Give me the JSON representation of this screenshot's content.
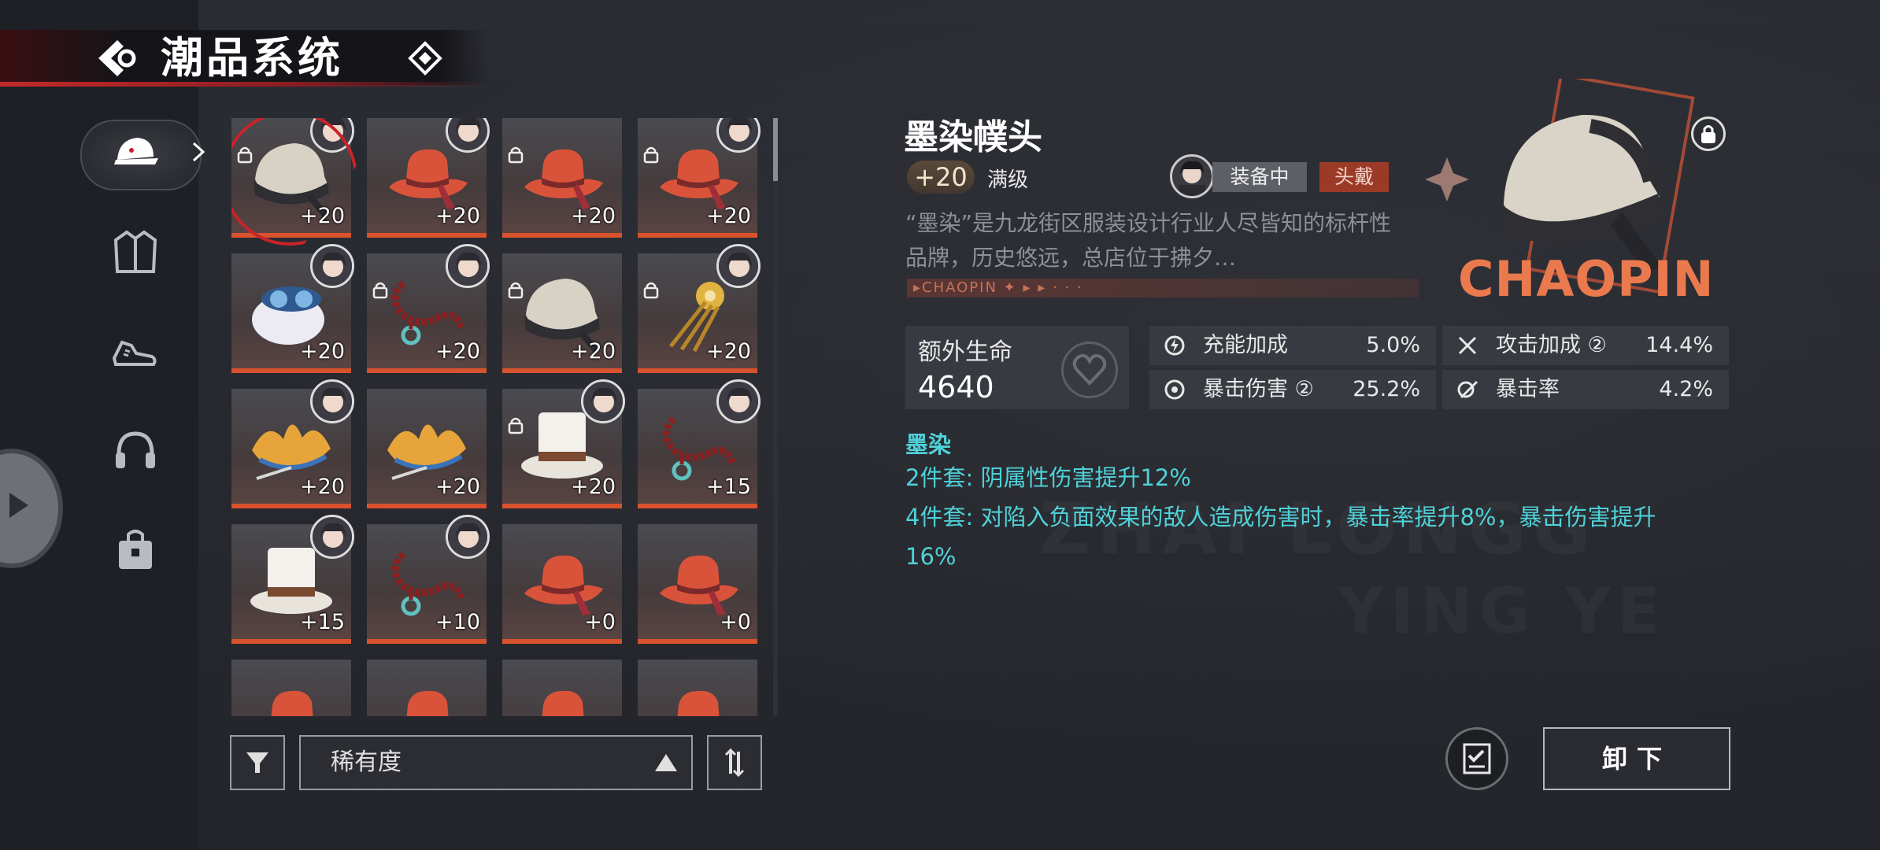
{
  "header": {
    "title": "潮品系统"
  },
  "categories": [
    {
      "icon": "cap-icon",
      "active": true
    },
    {
      "icon": "jacket-icon",
      "active": false
    },
    {
      "icon": "sneakers-icon",
      "active": false
    },
    {
      "icon": "headphones-icon",
      "active": false
    },
    {
      "icon": "bag-icon",
      "active": false
    }
  ],
  "items": [
    {
      "kind": "black-hood",
      "level": "+20",
      "avatar": true,
      "locked": true,
      "selected": true
    },
    {
      "kind": "red-hat",
      "level": "+20",
      "avatar": true,
      "locked": false
    },
    {
      "kind": "red-hat",
      "level": "+20",
      "avatar": false,
      "locked": true
    },
    {
      "kind": "red-hat",
      "level": "+20",
      "avatar": true,
      "locked": true
    },
    {
      "kind": "white-cap",
      "level": "+20",
      "avatar": true,
      "locked": false
    },
    {
      "kind": "red-necklace",
      "level": "+20",
      "avatar": true,
      "locked": true
    },
    {
      "kind": "black-hood",
      "level": "+20",
      "avatar": false,
      "locked": true
    },
    {
      "kind": "gold-hairpin",
      "level": "+20",
      "avatar": true,
      "locked": true
    },
    {
      "kind": "gold-crown",
      "level": "+20",
      "avatar": true,
      "locked": false
    },
    {
      "kind": "gold-crown",
      "level": "+20",
      "avatar": false,
      "locked": false
    },
    {
      "kind": "top-hat",
      "level": "+20",
      "avatar": true,
      "locked": true
    },
    {
      "kind": "red-necklace",
      "level": "+15",
      "avatar": true,
      "locked": false
    },
    {
      "kind": "top-hat",
      "level": "+15",
      "avatar": true,
      "locked": false
    },
    {
      "kind": "red-necklace",
      "level": "+10",
      "avatar": true,
      "locked": false
    },
    {
      "kind": "red-hat",
      "level": "+0",
      "avatar": false,
      "locked": false
    },
    {
      "kind": "red-hat",
      "level": "+0",
      "avatar": false,
      "locked": false
    },
    {
      "kind": "red-hat",
      "level": "",
      "avatar": false,
      "locked": false
    },
    {
      "kind": "red-hat",
      "level": "",
      "avatar": false,
      "locked": false
    },
    {
      "kind": "red-hat",
      "level": "",
      "avatar": false,
      "locked": false
    },
    {
      "kind": "red-hat",
      "level": "",
      "avatar": false,
      "locked": false
    }
  ],
  "sort": {
    "label": "稀有度"
  },
  "detail": {
    "name": "墨染幞头",
    "level_badge": "+20",
    "max_level": "满级",
    "status": "装备中",
    "slot": "头戴",
    "description": "“墨染”是九龙街区服装设计行业人尽皆知的标杆性品牌，历史悠远，总店位于拂夕…",
    "brand_strip": "▸CHAOPIN ✦ ▸ ▸ · · ·",
    "art_text": "CHAOPIN",
    "main_stat": {
      "label": "额外生命",
      "value": "4640"
    },
    "stats": [
      {
        "icon": "energy-icon",
        "label": "充能加成",
        "value": "5.0%"
      },
      {
        "icon": "swords-icon",
        "label": "攻击加成 ②",
        "value": "14.4%"
      },
      {
        "icon": "target-icon",
        "label": "暴击伤害 ②",
        "value": "25.2%"
      },
      {
        "icon": "crit-icon",
        "label": "暴击率",
        "value": "4.2%"
      }
    ],
    "set": {
      "name": "墨染",
      "bonus2": "2件套: 阴属性伤害提升12%",
      "bonus4": "4件套: 对陷入负面效果的敌人造成伤害时，暴击率提升8%，暴击伤害提升",
      "bonus4_cont": "16%"
    }
  },
  "buttons": {
    "unequip": "卸下"
  },
  "colors": {
    "accent_red": "#c9232b",
    "set_cyan": "#4fd1d8",
    "rarity_orange": "#d8522e"
  }
}
